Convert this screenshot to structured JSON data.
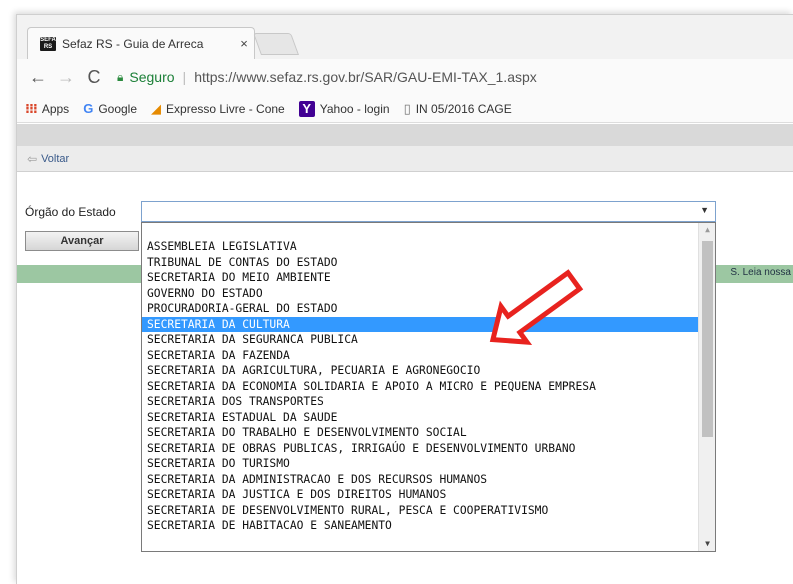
{
  "browser": {
    "tab_title": "Sefaz RS - Guia de Arreca",
    "tab_close": "×",
    "favicon_text": "SEFA RS",
    "secure_label": "Seguro",
    "url": "https://www.sefaz.rs.gov.br/SAR/GAU-EMI-TAX_1.aspx",
    "back_icon": "←",
    "forward_icon": "→",
    "reload_icon": "C"
  },
  "bookmarks": [
    {
      "icon": "apps-icon",
      "glyph": "⁝⁝⁝",
      "label": "Apps"
    },
    {
      "icon": "google-icon",
      "glyph": "G",
      "label": "Google"
    },
    {
      "icon": "expresso-icon",
      "glyph": "◢",
      "label": "Expresso Livre - Cone"
    },
    {
      "icon": "yahoo-icon",
      "glyph": "Y",
      "label": "Yahoo - login"
    },
    {
      "icon": "document-icon",
      "glyph": "▯",
      "label": "IN 05/2016 CAGE"
    }
  ],
  "page": {
    "voltar_label": "Voltar",
    "orgao_label": "Órgão do Estado",
    "avancar_label": "Avançar",
    "green_text": "S. Leia nossa",
    "select_value": ""
  },
  "dropdown": {
    "items": [
      "ASSEMBLEIA LEGISLATIVA",
      "TRIBUNAL DE CONTAS DO ESTADO",
      "SECRETARIA DO MEIO AMBIENTE",
      "GOVERNO DO ESTADO",
      "PROCURADORIA-GERAL DO ESTADO",
      "SECRETARIA DA CULTURA",
      "SECRETARIA DA SEGURANCA PUBLICA",
      "SECRETARIA DA FAZENDA",
      "SECRETARIA DA AGRICULTURA, PECUARIA E AGRONEGOCIO",
      "SECRETARIA DA ECONOMIA SOLIDARIA E APOIO A MICRO E PEQUENA EMPRESA",
      "SECRETARIA DOS TRANSPORTES",
      "SECRETARIA ESTADUAL DA SAUDE",
      "SECRETARIA DO TRABALHO E DESENVOLVIMENTO SOCIAL",
      "SECRETARIA DE OBRAS PUBLICAS, IRRIGAÚO E DESENVOLVIMENTO URBANO",
      "SECRETARIA DO TURISMO",
      "SECRETARIA DA ADMINISTRACAO E DOS RECURSOS HUMANOS",
      "SECRETARIA DA JUSTICA E DOS DIREITOS HUMANOS",
      "SECRETARIA DE DESENVOLVIMENTO RURAL, PESCA E COOPERATIVISMO",
      "SECRETARIA DE HABITACAO E SANEAMENTO"
    ],
    "selected_index": 5
  },
  "colors": {
    "selection": "#3399ff",
    "annotation_arrow": "#e8231f",
    "green_bar": "#9cc7a2"
  }
}
